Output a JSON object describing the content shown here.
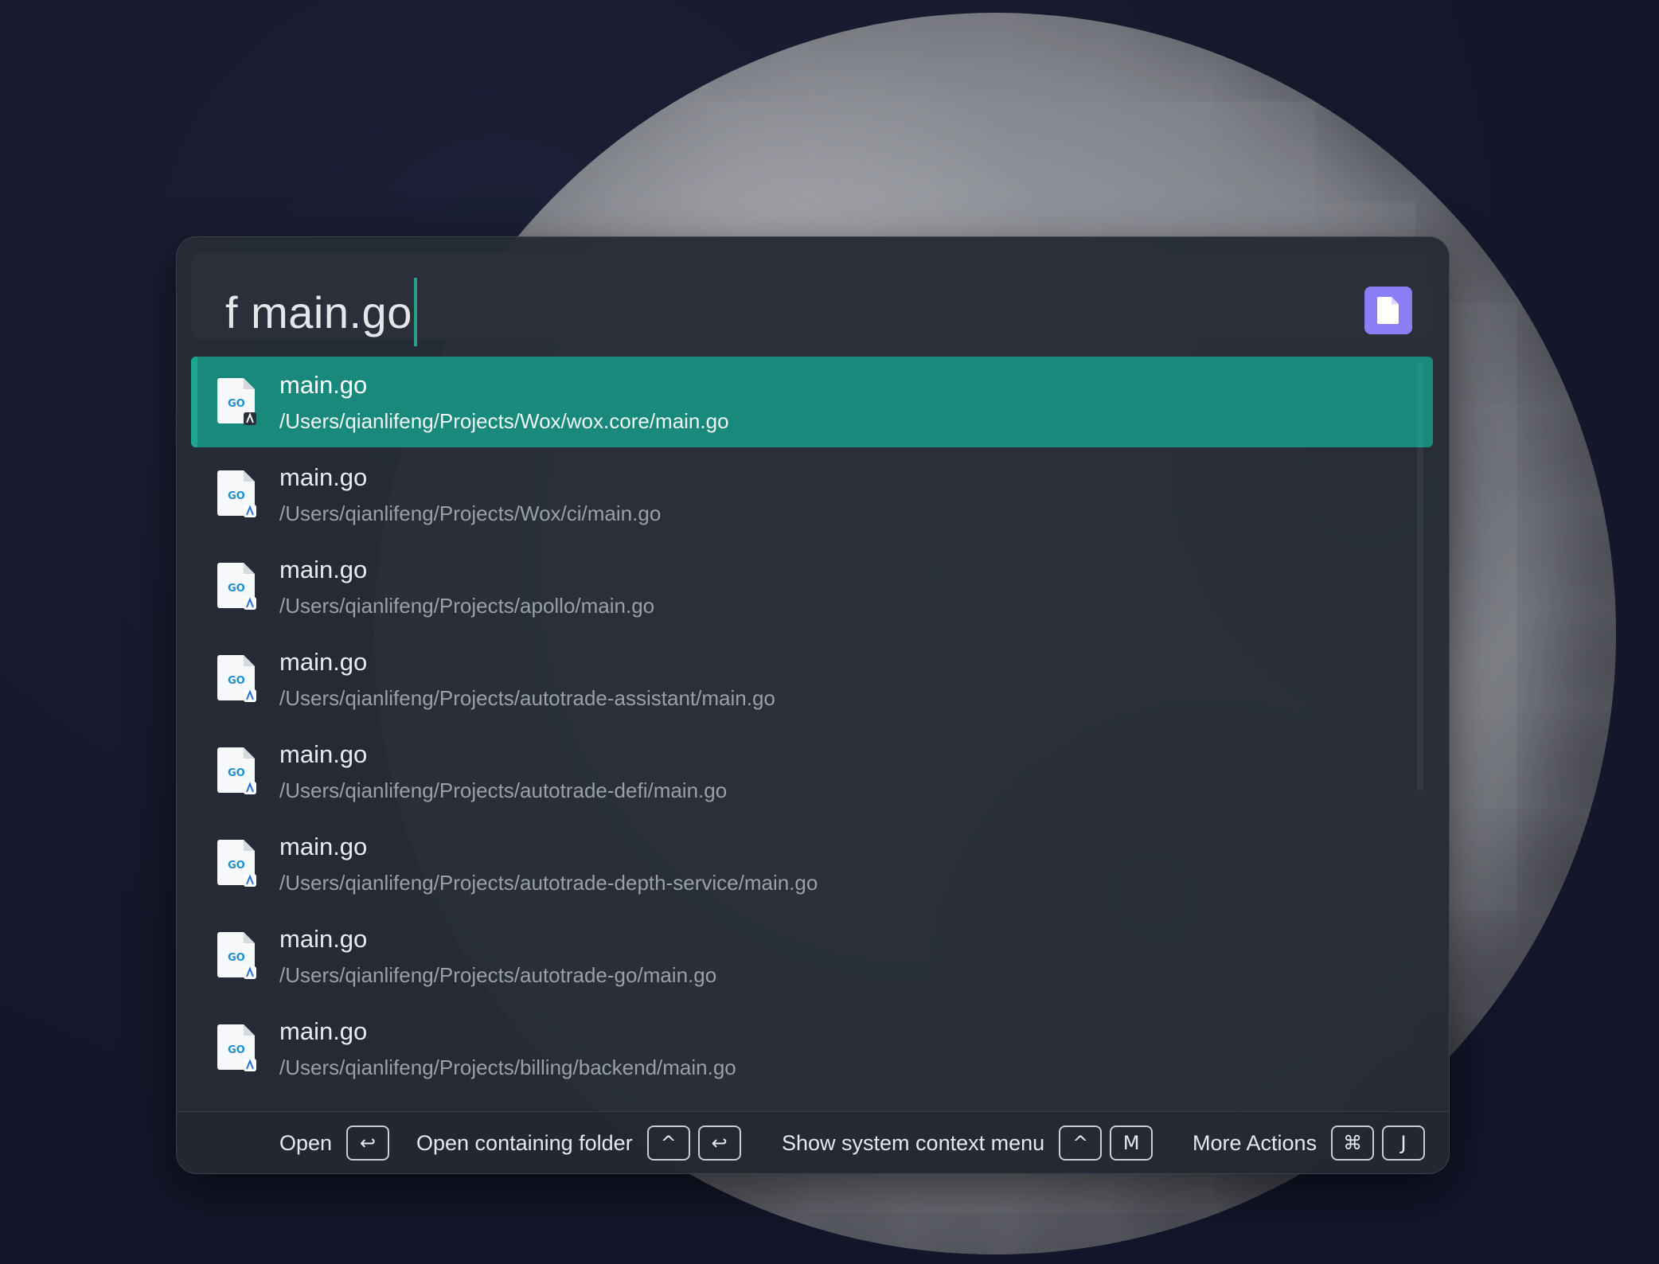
{
  "query": {
    "text": "f main.go"
  },
  "plugin": {
    "icon": "file-icon",
    "color": "#8b7ef5"
  },
  "colors": {
    "selection": "#18897a",
    "caret": "#26a08a"
  },
  "results": [
    {
      "title": "main.go",
      "subtitle": "/Users/qianlifeng/Projects/Wox/wox.core/main.go",
      "icon": "go-file-icon",
      "selected": true
    },
    {
      "title": "main.go",
      "subtitle": "/Users/qianlifeng/Projects/Wox/ci/main.go",
      "icon": "go-file-icon",
      "selected": false
    },
    {
      "title": "main.go",
      "subtitle": "/Users/qianlifeng/Projects/apollo/main.go",
      "icon": "go-file-icon",
      "selected": false
    },
    {
      "title": "main.go",
      "subtitle": "/Users/qianlifeng/Projects/autotrade-assistant/main.go",
      "icon": "go-file-icon",
      "selected": false
    },
    {
      "title": "main.go",
      "subtitle": "/Users/qianlifeng/Projects/autotrade-defi/main.go",
      "icon": "go-file-icon",
      "selected": false
    },
    {
      "title": "main.go",
      "subtitle": "/Users/qianlifeng/Projects/autotrade-depth-service/main.go",
      "icon": "go-file-icon",
      "selected": false
    },
    {
      "title": "main.go",
      "subtitle": "/Users/qianlifeng/Projects/autotrade-go/main.go",
      "icon": "go-file-icon",
      "selected": false
    },
    {
      "title": "main.go",
      "subtitle": "/Users/qianlifeng/Projects/billing/backend/main.go",
      "icon": "go-file-icon",
      "selected": false
    }
  ],
  "actions": [
    {
      "label": "Open",
      "keys": [
        "↩"
      ]
    },
    {
      "label": "Open containing folder",
      "keys": [
        "^",
        "↩"
      ]
    },
    {
      "label": "Show system context menu",
      "keys": [
        "^",
        "M"
      ]
    },
    {
      "label": "More Actions",
      "keys": [
        "⌘",
        "J"
      ]
    }
  ]
}
